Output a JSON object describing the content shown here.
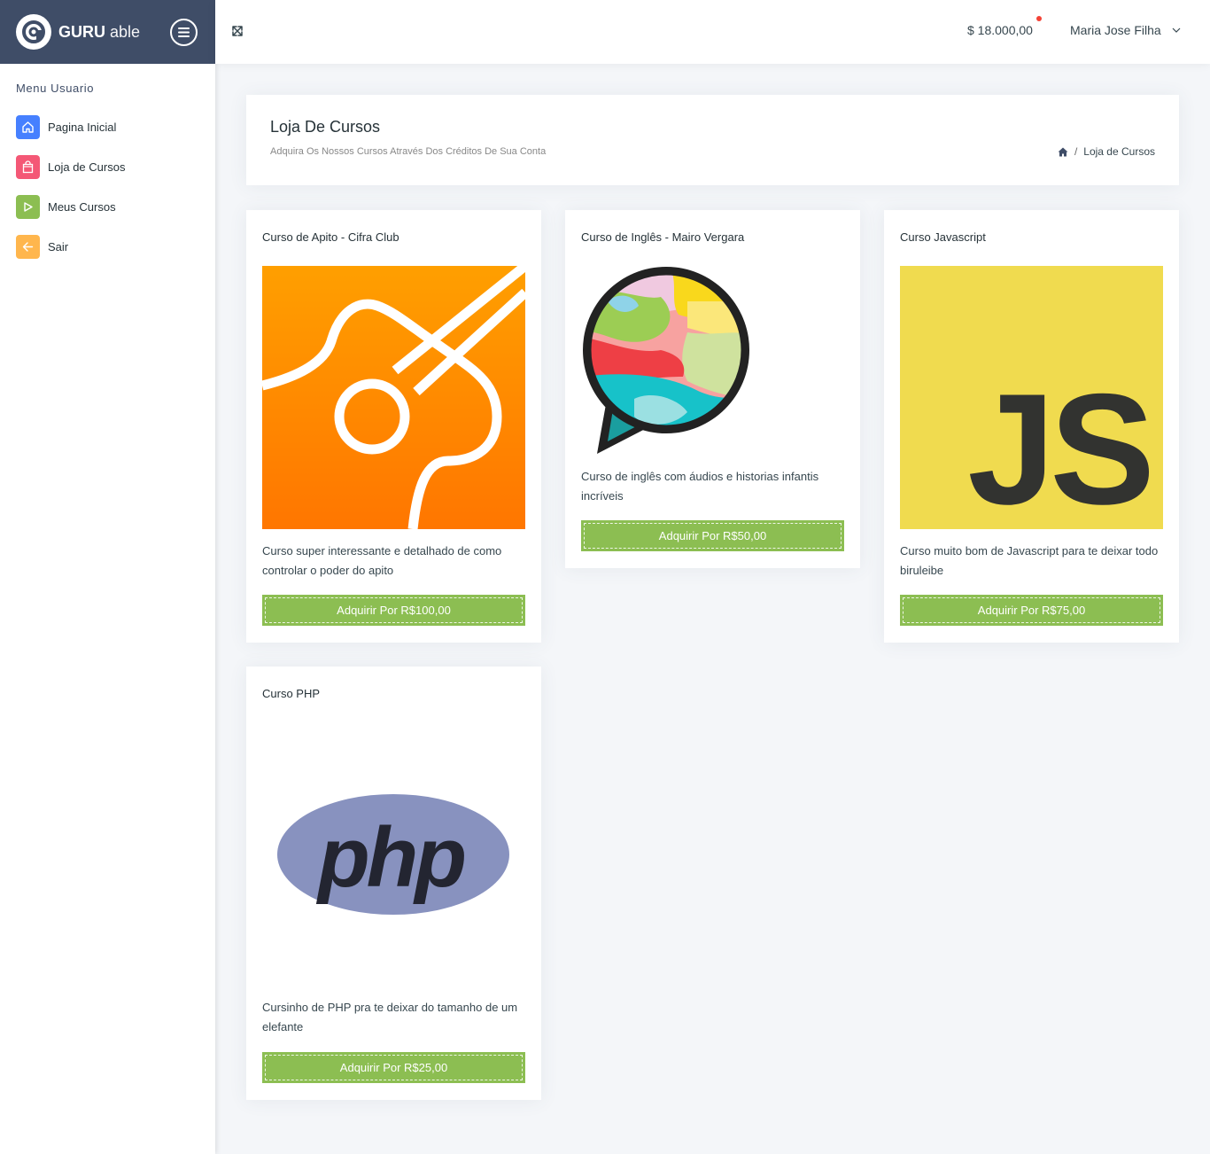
{
  "brand": {
    "strong": "GURU",
    "light": "able"
  },
  "sidebar": {
    "caption": "Menu Usuario",
    "items": [
      {
        "label": "Pagina Inicial",
        "icon": "home-icon",
        "color": "#4680ff"
      },
      {
        "label": "Loja de Cursos",
        "icon": "shopping-bag-icon",
        "color": "#f45876"
      },
      {
        "label": "Meus Cursos",
        "icon": "play-icon",
        "color": "#8cbe52"
      },
      {
        "label": "Sair",
        "icon": "arrow-left-icon",
        "color": "#ffb64d"
      }
    ]
  },
  "header": {
    "balance": "$  18.000,00",
    "user_name": "Maria Jose Filha"
  },
  "page": {
    "title": "Loja De Cursos",
    "subtitle": "Adquira Os Nossos Cursos Através Dos Créditos De Sua Conta",
    "breadcrumb_current": "Loja de Cursos"
  },
  "courses": [
    {
      "title": "Curso de Apito - Cifra Club",
      "description": "Curso super interessante e detalhado de como controlar o poder do apito",
      "button": "Adquirir Por R$100,00",
      "image": "guitar-icon"
    },
    {
      "title": "Curso de Inglês - Mairo Vergara",
      "description": "Curso de inglês com áudios e historias infantis incríveis",
      "button": "Adquirir Por R$50,00",
      "image": "speech-bubble-world-map"
    },
    {
      "title": "Curso Javascript",
      "description": "Curso muito bom de Javascript para te deixar todo biruleibe",
      "button": "Adquirir Por R$75,00",
      "image": "javascript-logo",
      "logo_text": "JS"
    },
    {
      "title": "Curso PHP",
      "description": "Cursinho de PHP pra te deixar do tamanho de um elefante",
      "button": "Adquirir Por R$25,00",
      "image": "php-logo",
      "logo_text": "php"
    }
  ]
}
